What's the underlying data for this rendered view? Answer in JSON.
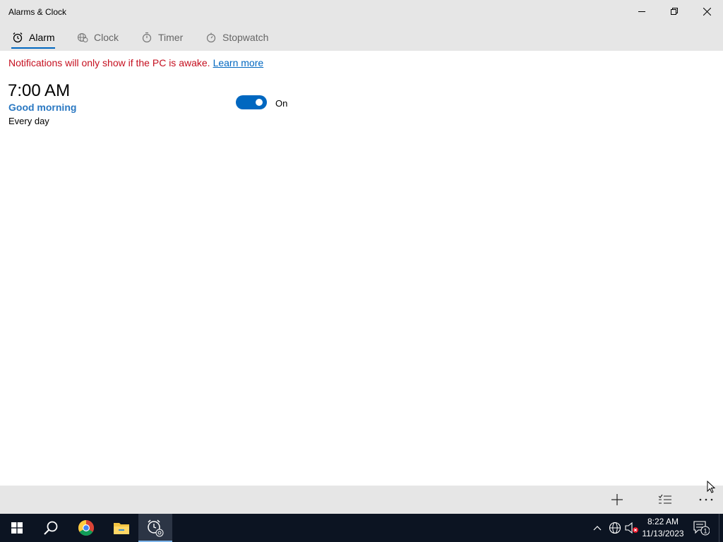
{
  "window": {
    "title": "Alarms & Clock"
  },
  "tabs": [
    {
      "label": "Alarm",
      "icon": "alarm-clock-icon",
      "active": true
    },
    {
      "label": "Clock",
      "icon": "globe-clock-icon",
      "active": false
    },
    {
      "label": "Timer",
      "icon": "timer-icon",
      "active": false
    },
    {
      "label": "Stopwatch",
      "icon": "stopwatch-icon",
      "active": false
    }
  ],
  "notice": {
    "text": "Notifications will only show if the PC is awake.",
    "link": "Learn more"
  },
  "alarms": [
    {
      "time": "7:00 AM",
      "name": "Good morning",
      "repeat": "Every day",
      "state": "On",
      "enabled": true
    }
  ],
  "commandbar": {
    "add_icon": "plus-icon",
    "edit_icon": "select-list-icon",
    "more_icon": "more-ellipsis-icon"
  },
  "taskbar": {
    "apps": [
      "windows-start-icon",
      "search-icon",
      "chrome-icon",
      "file-explorer-icon",
      "alarms-clock-icon"
    ],
    "time": "8:22 AM",
    "date": "11/13/2023",
    "notification_count": "1"
  },
  "colors": {
    "accent": "#0067c0",
    "warning_text": "#c50f1f",
    "alarm_name": "#2a78c2",
    "chrome_bg": "#e6e6e6",
    "taskbar_bg": "#0c1422"
  }
}
